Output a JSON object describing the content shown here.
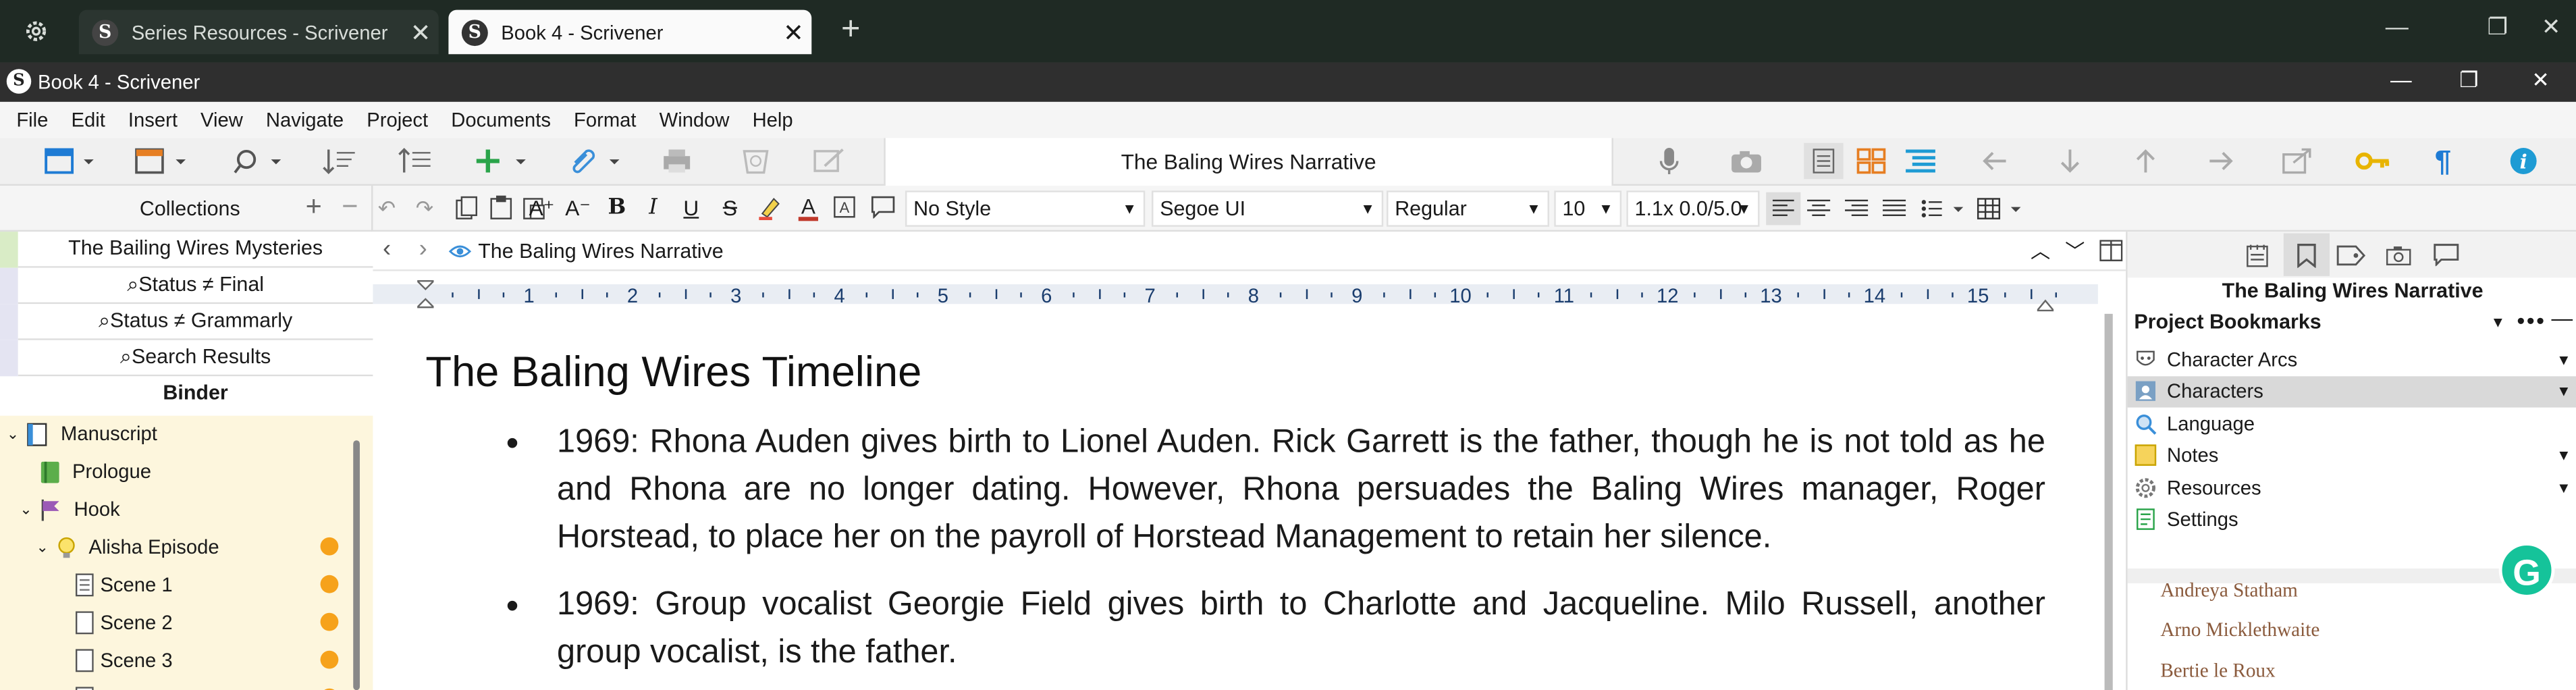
{
  "browser": {
    "tabs": [
      {
        "title": "Series Resources - Scrivener"
      },
      {
        "title": "Book 4 - Scrivener"
      }
    ]
  },
  "window": {
    "title": "Book 4 - Scrivener"
  },
  "menu": [
    "File",
    "Edit",
    "Insert",
    "View",
    "Navigate",
    "Project",
    "Documents",
    "Format",
    "Window",
    "Help"
  ],
  "toolbar": {
    "document_title": "The Baling Wires Narrative"
  },
  "format": {
    "style": "No Style",
    "font": "Segoe UI",
    "weight": "Regular",
    "size": "10",
    "spacing": "1.1x 0.0/5.0"
  },
  "collections": {
    "header": "Collections",
    "items": [
      {
        "label": "The Bailing Wires Mysteries"
      },
      {
        "label": "⌕Status ≠ Final"
      },
      {
        "label": "⌕Status ≠ Grammarly"
      },
      {
        "label": "⌕Search Results"
      },
      {
        "label": "Binder"
      }
    ],
    "colors": [
      "#d9ecc6",
      "#e4e4f2",
      "#e4e4f2",
      "#e4e4f2",
      "#ffffff"
    ]
  },
  "binder": {
    "items": [
      {
        "label": "Manuscript"
      },
      {
        "label": "Prologue"
      },
      {
        "label": "Hook"
      },
      {
        "label": "Alisha Episode"
      },
      {
        "label": "Scene 1"
      },
      {
        "label": "Scene 2"
      },
      {
        "label": "Scene 3"
      }
    ],
    "label_color": "#f6a21b"
  },
  "editor": {
    "header_title": "The Baling Wires Narrative",
    "ruler_numbers": [
      "1",
      "2",
      "3",
      "4",
      "5",
      "6",
      "7",
      "8",
      "9",
      "10",
      "11",
      "12",
      "13",
      "14",
      "15"
    ],
    "heading": "The Baling Wires Timeline",
    "paragraphs": [
      "1969: Rhona Auden gives birth to Lionel Auden. Rick Garrett is the father, though he is not told as he and Rhona are no longer dating. However, Rhona persuades the Baling Wires manager, Roger Horstead, to place her on the payroll of Horstead Management to retain her silence.",
      "1969: Group vocalist Georgie Field gives birth to Charlotte and Jacqueline. Milo Russell, another group vocalist, is the father."
    ]
  },
  "inspector": {
    "doc_title": "The Baling Wires Narrative",
    "bookmarks_header": "Project Bookmarks",
    "bookmarks": [
      {
        "label": "Character Arcs"
      },
      {
        "label": "Characters"
      },
      {
        "label": "Language"
      },
      {
        "label": "Notes"
      },
      {
        "label": "Resources"
      },
      {
        "label": "Settings"
      }
    ],
    "names": [
      "Andreya Statham",
      "Arno Micklethwaite",
      "Bertie le Roux"
    ]
  }
}
